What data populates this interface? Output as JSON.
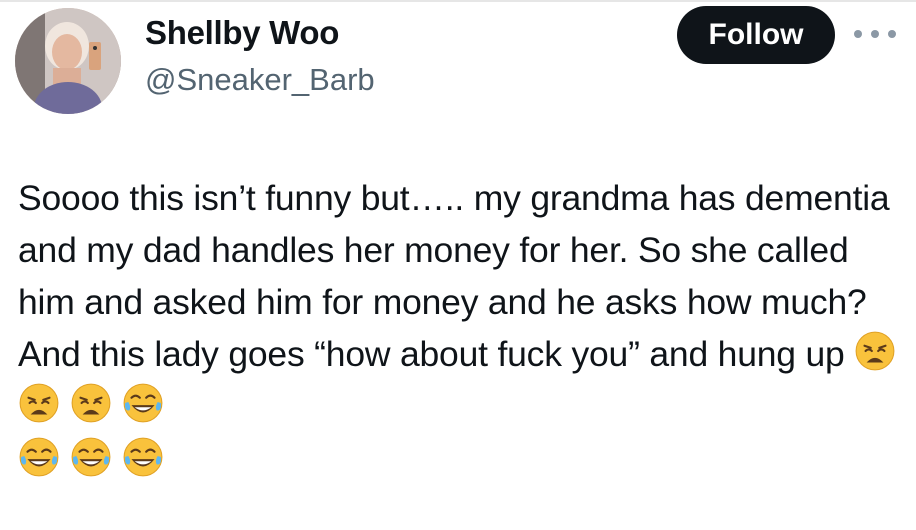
{
  "author": {
    "display_name": "Shellby Woo",
    "handle": "@Sneaker_Barb",
    "avatar_icon": "profile-photo"
  },
  "actions": {
    "follow_label": "Follow",
    "more_icon": "more-horizontal-icon"
  },
  "tweet": {
    "text": "Soooo this isn’t funny but….. my grandma has dementia and my dad handles her money for her. So she called him and asked him for money and he asks how much? And this lady goes “how about fuck you” and hung up ",
    "emojis_inline": [
      "weary-face-emoji",
      "weary-face-emoji",
      "weary-face-emoji",
      "laughing-tears-emoji"
    ],
    "emojis_second_line": [
      "laughing-tears-emoji",
      "laughing-tears-emoji",
      "laughing-tears-emoji"
    ]
  },
  "colors": {
    "text_primary": "#0f1419",
    "text_secondary": "#536471",
    "button_bg": "#0f1419",
    "button_text": "#ffffff",
    "emoji_yellow": "#f9c23c"
  }
}
